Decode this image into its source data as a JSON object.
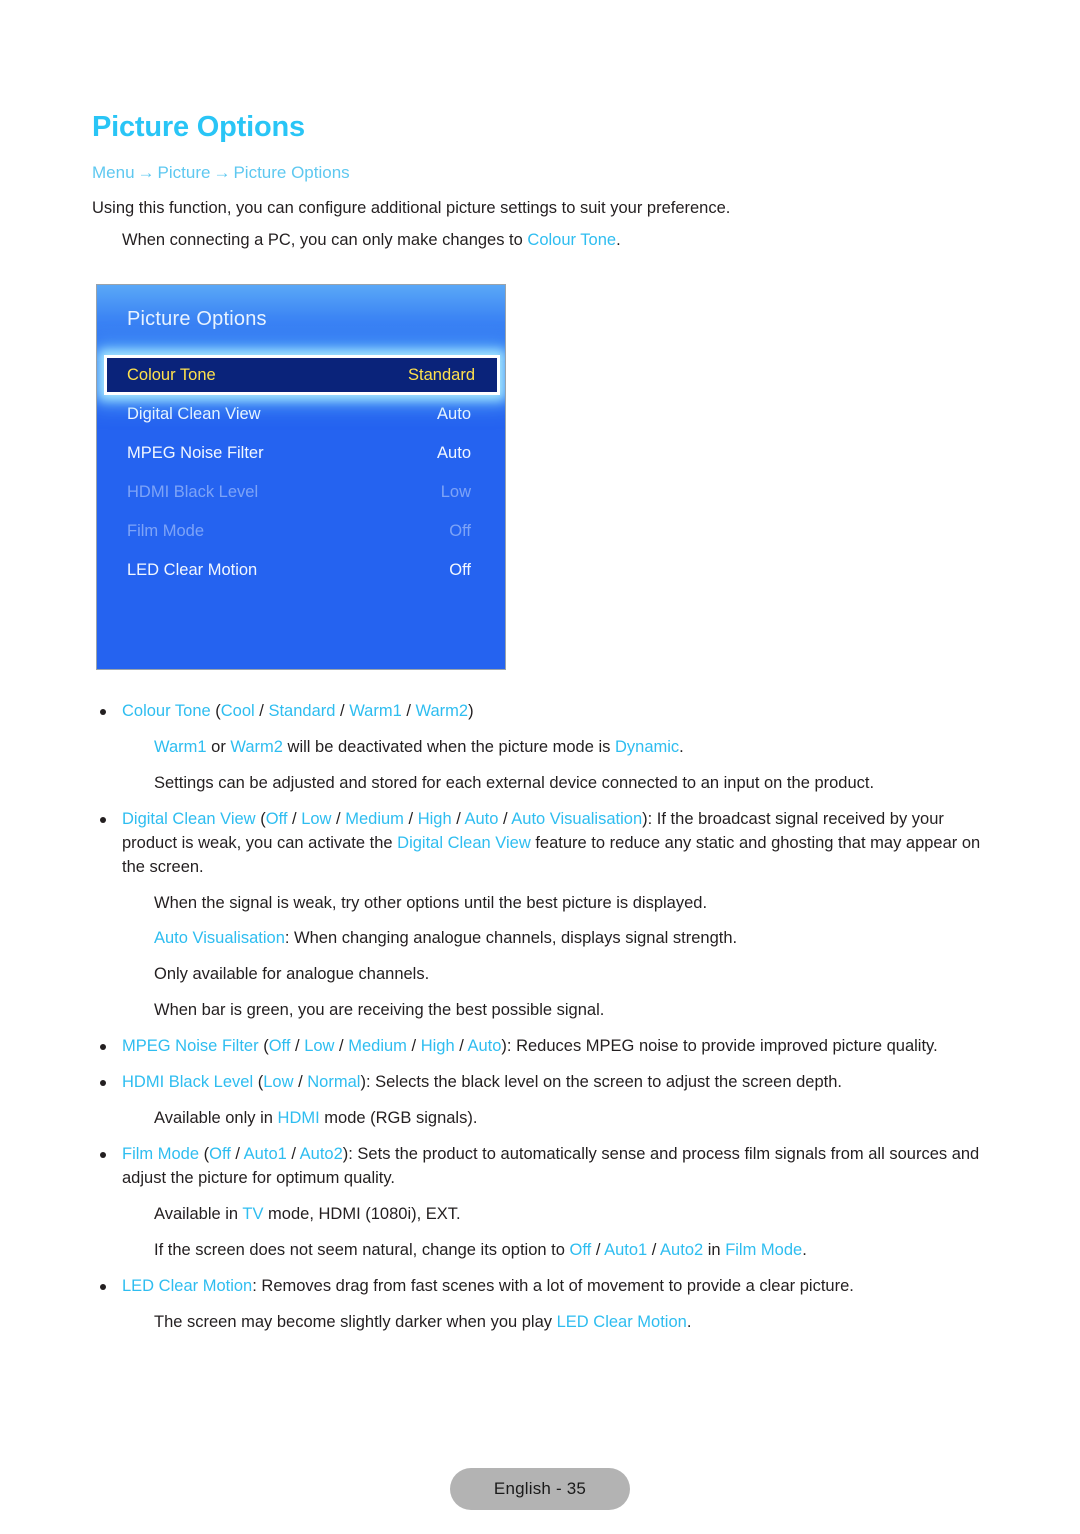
{
  "page": {
    "title": "Picture Options",
    "footer_label": "English - 35"
  },
  "breadcrumb": {
    "items": [
      "Menu",
      "Picture",
      "Picture Options"
    ],
    "separator": "→"
  },
  "intro": {
    "line1": "Using this function, you can configure additional picture settings to suit your preference.",
    "line2_pre": "When connecting a PC, you can only make changes to ",
    "line2_link": "Colour Tone",
    "line2_post": "."
  },
  "osd": {
    "header_title": "Picture Options",
    "rows": [
      {
        "label": "Colour Tone",
        "value": "Standard",
        "state": "selected"
      },
      {
        "label": "Digital Clean View",
        "value": "Auto",
        "state": "normal"
      },
      {
        "label": "MPEG Noise Filter",
        "value": "Auto",
        "state": "normal"
      },
      {
        "label": "HDMI Black Level",
        "value": "Low",
        "state": "disabled"
      },
      {
        "label": "Film Mode",
        "value": "Off",
        "state": "disabled"
      },
      {
        "label": "LED Clear Motion",
        "value": "Off",
        "state": "normal"
      }
    ]
  },
  "colors": {
    "accent_heading": "#29c5f6",
    "accent_link": "#2ebdf0",
    "breadcrumb": "#5ec8f0",
    "osd_background": "#2563f0",
    "osd_selected_bg": "#0a237a",
    "osd_selected_text": "#ffe14d",
    "body_text": "#231f20",
    "footer_pill_bg": "#b3b3b3"
  },
  "body": {
    "colour_tone": {
      "name": "Colour Tone",
      "options": [
        "Cool",
        "Standard",
        "Warm1",
        "Warm2"
      ],
      "note1_a": "Warm1",
      "note1_b": " or ",
      "note1_c": "Warm2",
      "note1_d": " will be deactivated when the picture mode is ",
      "note1_e": "Dynamic",
      "note1_f": ".",
      "note2": "Settings can be adjusted and stored for each external device connected to an input on the product."
    },
    "digital_clean_view": {
      "name": "Digital Clean View",
      "options": [
        "Off",
        "Low",
        "Medium",
        "High",
        "Auto",
        "Auto Visualisation"
      ],
      "desc_a": "): If the broadcast signal received by your product is weak, you can activate the ",
      "desc_link": "Digital Clean View",
      "desc_b": " feature to reduce any static and ghosting that may appear on the screen.",
      "note1": "When the signal is weak, try other options until the best picture is displayed.",
      "av_name": "Auto Visualisation",
      "av_desc": ": When changing analogue channels, displays signal strength.",
      "av_note1": "Only available for analogue channels.",
      "av_note2": "When bar is green, you are receiving the best possible signal."
    },
    "mpeg_noise_filter": {
      "name": "MPEG Noise Filter",
      "options": [
        "Off",
        "Low",
        "Medium",
        "High",
        "Auto"
      ],
      "desc": "): Reduces MPEG noise to provide improved picture quality."
    },
    "hdmi_black_level": {
      "name": "HDMI Black Level",
      "options": [
        "Low",
        "Normal"
      ],
      "desc": "): Selects the black level on the screen to adjust the screen depth.",
      "note_a": "Available only in ",
      "note_link": "HDMI",
      "note_b": " mode (RGB signals)."
    },
    "film_mode": {
      "name": "Film Mode",
      "options": [
        "Off",
        "Auto1",
        "Auto2"
      ],
      "desc": "): Sets the product to automatically sense and process film signals from all sources and adjust the picture for optimum quality.",
      "note1_a": "Available in ",
      "note1_link": "TV",
      "note1_b": " mode, HDMI (1080i), EXT.",
      "note2_a": "If the screen does not seem natural, change its option to ",
      "note2_opt1": "Off",
      "note2_opt2": "Auto1",
      "note2_opt3": "Auto2",
      "note2_b": " in ",
      "note2_link": "Film Mode",
      "note2_c": "."
    },
    "led_clear_motion": {
      "name": "LED Clear Motion",
      "desc": ": Removes drag from fast scenes with a lot of movement to provide a clear picture.",
      "note_a": "The screen may become slightly darker when you play ",
      "note_link": "LED Clear Motion",
      "note_b": "."
    }
  }
}
